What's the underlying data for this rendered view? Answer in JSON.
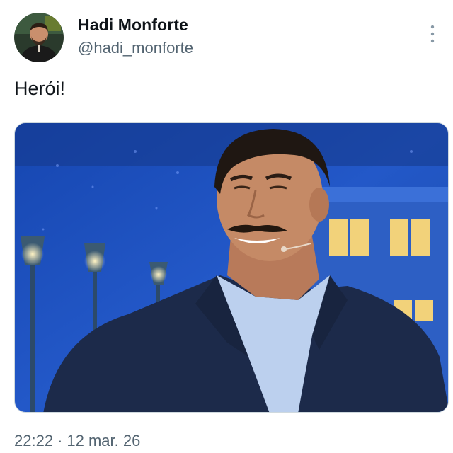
{
  "author": {
    "display_name": "Hadi Monforte",
    "handle": "@hadi_monforte",
    "avatar_icon": "user-avatar"
  },
  "tweet": {
    "text": "Herói!",
    "time": "22:22",
    "separator": "·",
    "date": "12 mar. 26"
  },
  "menu": {
    "icon": "more-vertical-icon"
  },
  "colors": {
    "primary_text": "#0f1419",
    "secondary_text": "#536471",
    "stage_blue": "#1e4fb8",
    "suit_navy": "#1c2a4a"
  }
}
